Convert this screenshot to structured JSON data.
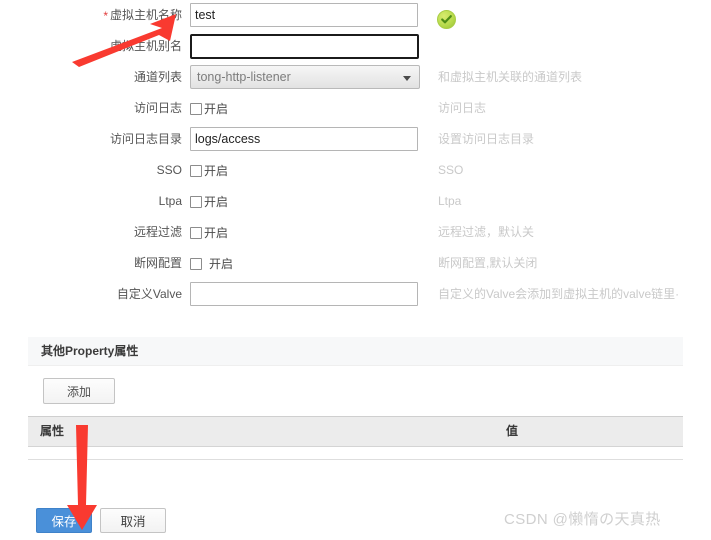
{
  "form": {
    "rows": [
      {
        "label": "虚拟主机名称",
        "required": true,
        "type": "text",
        "value": "test",
        "placeholder": "",
        "hint": "",
        "status_icon": "check-circle-icon"
      },
      {
        "label": "虚拟主机别名",
        "required": false,
        "type": "text",
        "value": "",
        "placeholder": "",
        "hint": "",
        "focused": true
      },
      {
        "label": "通道列表",
        "required": false,
        "type": "select",
        "value": "tong-http-listener",
        "hint": "和虚拟主机关联的通道列表"
      },
      {
        "label": "访问日志",
        "required": false,
        "type": "checkbox",
        "checkbox_label": "开启",
        "checked": false,
        "hint": "访问日志"
      },
      {
        "label": "访问日志目录",
        "required": false,
        "type": "text",
        "value": "logs/access",
        "placeholder": "",
        "hint": "设置访问日志目录"
      },
      {
        "label": "SSO",
        "required": false,
        "type": "checkbox",
        "checkbox_label": "开启",
        "checked": false,
        "hint": "SSO"
      },
      {
        "label": "Ltpa",
        "required": false,
        "type": "checkbox",
        "checkbox_label": "开启",
        "checked": false,
        "hint": "Ltpa"
      },
      {
        "label": "远程过滤",
        "required": false,
        "type": "checkbox",
        "checkbox_label": "开启",
        "checked": false,
        "hint": "远程过滤，默认关"
      },
      {
        "label": "断网配置",
        "required": false,
        "type": "checkbox",
        "checkbox_label": "开启",
        "checked": false,
        "hint": "断网配置,默认关闭",
        "wide_gap": true
      },
      {
        "label": "自定义Valve",
        "required": false,
        "type": "text",
        "value": "",
        "placeholder": "",
        "hint": "自定义的Valve会添加到虚拟主机的valve链里·"
      }
    ],
    "required_marker": "*"
  },
  "property_section": {
    "title": "其他Property属性",
    "add_button": "添加",
    "table": {
      "columns": [
        "属性",
        "值"
      ],
      "rows": []
    }
  },
  "footer": {
    "save_label": "保存",
    "cancel_label": "取消"
  },
  "watermark": {
    "text": "CSDN @懒惰の天真热"
  },
  "colors": {
    "accent": "#4a90d9",
    "required_star": "#e23c3c",
    "hint_text": "#c9c9c9",
    "annotation_arrow": "#f93a30",
    "success_badge": "#b5d94a"
  },
  "annotations": [
    {
      "name": "arrow-to-hostname-label",
      "direction": "up-right"
    },
    {
      "name": "arrow-to-save-button",
      "direction": "down"
    }
  ]
}
